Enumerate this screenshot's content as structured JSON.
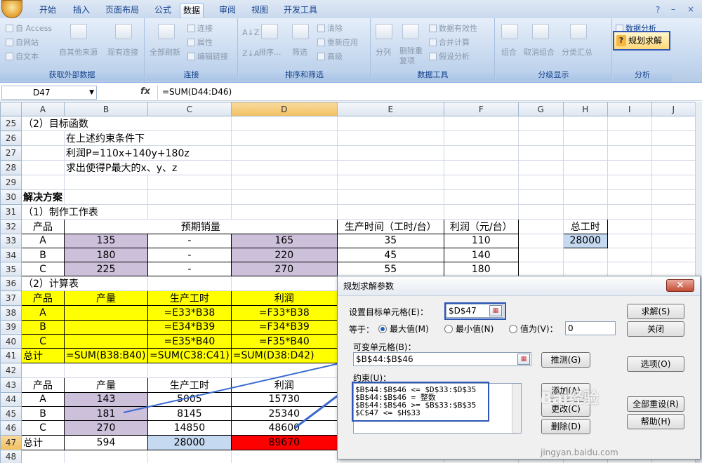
{
  "tabs": [
    "开始",
    "插入",
    "页面布局",
    "公式",
    "数据",
    "审阅",
    "视图",
    "开发工具"
  ],
  "active_tab": "数据",
  "ribbon": {
    "external": {
      "title": "获取外部数据",
      "items": [
        "自 Access",
        "自网站",
        "自文本",
        "自其他来源",
        "现有连接"
      ]
    },
    "connections": {
      "title": "连接",
      "items": [
        "全部刷新",
        "连接",
        "属性",
        "编辑链接"
      ]
    },
    "sort": {
      "title": "排序和筛选",
      "items": [
        "排序...",
        "筛选",
        "清除",
        "重新应用",
        "高级"
      ]
    },
    "tools": {
      "title": "数据工具",
      "items": [
        "分列",
        "删除重复项",
        "数据有效性",
        "合并计算",
        "假设分析"
      ]
    },
    "outline": {
      "title": "分级显示",
      "items": [
        "组合",
        "取消组合",
        "分类汇总"
      ]
    },
    "analysis": {
      "title": "分析",
      "items": [
        "数据分析",
        "规划求解"
      ]
    }
  },
  "formula_bar": {
    "name_box": "D47",
    "fx": "fx",
    "formula": "=SUM(D44:D46)"
  },
  "columns": [
    "A",
    "B",
    "C",
    "D",
    "E",
    "F",
    "G",
    "H",
    "I",
    "J"
  ],
  "selected_col": "D",
  "rows": [
    {
      "n": "25",
      "cells": [
        {
          "t": "（2）目标函数",
          "span": 3
        }
      ]
    },
    {
      "n": "26",
      "cells": [
        {
          "t": ""
        },
        {
          "t": "在上述约束条件下",
          "span": 2
        }
      ]
    },
    {
      "n": "27",
      "cells": [
        {
          "t": ""
        },
        {
          "t": "利润P=110x+140y+180z",
          "span": 2
        }
      ]
    },
    {
      "n": "28",
      "cells": [
        {
          "t": ""
        },
        {
          "t": "求出使得P最大的x、y、z",
          "span": 2
        }
      ]
    },
    {
      "n": "29",
      "cells": []
    },
    {
      "n": "30",
      "cells": [
        {
          "t": "解决方案",
          "bold": true
        }
      ]
    },
    {
      "n": "31",
      "cells": [
        {
          "t": "（1）制作工作表",
          "span": 2
        }
      ]
    },
    {
      "n": "32",
      "cells": [
        {
          "t": "产品",
          "c": "c b"
        },
        {
          "t": "预期销量",
          "span": 3,
          "c": "c b"
        },
        {
          "t": "生产时间（工时/台）",
          "c": "c b"
        },
        {
          "t": "利润（元/台）",
          "c": "c b"
        },
        {
          "t": ""
        },
        {
          "t": "总工时",
          "c": "c b"
        }
      ]
    },
    {
      "n": "33",
      "cells": [
        {
          "t": "A",
          "c": "c b"
        },
        {
          "t": "135",
          "c": "c b pur"
        },
        {
          "t": "-",
          "c": "c b"
        },
        {
          "t": "165",
          "c": "c b pur"
        },
        {
          "t": "35",
          "c": "c b"
        },
        {
          "t": "110",
          "c": "c b"
        },
        {
          "t": ""
        },
        {
          "t": "28000",
          "c": "c b blu"
        }
      ]
    },
    {
      "n": "34",
      "cells": [
        {
          "t": "B",
          "c": "c b"
        },
        {
          "t": "180",
          "c": "c b pur"
        },
        {
          "t": "-",
          "c": "c b"
        },
        {
          "t": "220",
          "c": "c b pur"
        },
        {
          "t": "45",
          "c": "c b"
        },
        {
          "t": "140",
          "c": "c b"
        }
      ]
    },
    {
      "n": "35",
      "cells": [
        {
          "t": "C",
          "c": "c b"
        },
        {
          "t": "225",
          "c": "c b pur"
        },
        {
          "t": "-",
          "c": "c b"
        },
        {
          "t": "270",
          "c": "c b pur"
        },
        {
          "t": "55",
          "c": "c b"
        },
        {
          "t": "180",
          "c": "c b"
        }
      ]
    },
    {
      "n": "36",
      "cells": [
        {
          "t": "（2）计算表",
          "span": 2
        }
      ]
    },
    {
      "n": "37",
      "cells": [
        {
          "t": "产品",
          "c": "c b yel"
        },
        {
          "t": "产量",
          "c": "c b yel"
        },
        {
          "t": "生产工时",
          "c": "c b yel"
        },
        {
          "t": "利润",
          "c": "c b yel"
        }
      ]
    },
    {
      "n": "38",
      "cells": [
        {
          "t": "A",
          "c": "c b yel"
        },
        {
          "t": "",
          "c": "b yel"
        },
        {
          "t": "=E33*B38",
          "c": "c b yel"
        },
        {
          "t": "=F33*B38",
          "c": "c b yel"
        }
      ]
    },
    {
      "n": "39",
      "cells": [
        {
          "t": "B",
          "c": "c b yel"
        },
        {
          "t": "",
          "c": "b yel"
        },
        {
          "t": "=E34*B39",
          "c": "c b yel"
        },
        {
          "t": "=F34*B39",
          "c": "c b yel"
        }
      ]
    },
    {
      "n": "40",
      "cells": [
        {
          "t": "C",
          "c": "c b yel"
        },
        {
          "t": "",
          "c": "b yel"
        },
        {
          "t": "=E35*B40",
          "c": "c b yel"
        },
        {
          "t": "=F35*B40",
          "c": "c b yel"
        }
      ]
    },
    {
      "n": "41",
      "cells": [
        {
          "t": "总计",
          "c": "b yel"
        },
        {
          "t": "=SUM(B38:B40)",
          "c": "b yel"
        },
        {
          "t": "=SUM(C38:C41)",
          "c": "b yel"
        },
        {
          "t": "=SUM(D38:D42)",
          "c": "b yel"
        }
      ]
    },
    {
      "n": "42",
      "cells": []
    },
    {
      "n": "43",
      "cells": [
        {
          "t": "产品",
          "c": "c b"
        },
        {
          "t": "产量",
          "c": "c b"
        },
        {
          "t": "生产工时",
          "c": "c b"
        },
        {
          "t": "利润",
          "c": "c b"
        }
      ]
    },
    {
      "n": "44",
      "cells": [
        {
          "t": "A",
          "c": "c b"
        },
        {
          "t": "143",
          "c": "c b pur"
        },
        {
          "t": "5005",
          "c": "c b"
        },
        {
          "t": "15730",
          "c": "c b"
        }
      ]
    },
    {
      "n": "45",
      "cells": [
        {
          "t": "B",
          "c": "c b"
        },
        {
          "t": "181",
          "c": "c b pur"
        },
        {
          "t": "8145",
          "c": "c b"
        },
        {
          "t": "25340",
          "c": "c b"
        }
      ]
    },
    {
      "n": "46",
      "cells": [
        {
          "t": "C",
          "c": "c b"
        },
        {
          "t": "270",
          "c": "c b pur"
        },
        {
          "t": "14850",
          "c": "c b"
        },
        {
          "t": "48600",
          "c": "c b"
        }
      ]
    },
    {
      "n": "47",
      "cells": [
        {
          "t": "总计",
          "c": "b"
        },
        {
          "t": "594",
          "c": "c b"
        },
        {
          "t": "28000",
          "c": "c b blu"
        },
        {
          "t": "89670",
          "c": "c b red"
        }
      ]
    },
    {
      "n": "48",
      "cells": []
    }
  ],
  "dialog": {
    "title": "规划求解参数",
    "target_label": "设置目标单元格(E)：",
    "target_value": "$D$47",
    "equals_label": "等于：",
    "opt_max": "最大值(M)",
    "opt_min": "最小值(N)",
    "opt_value": "值为(V)：",
    "value_input": "0",
    "changing_label": "可变单元格(B)：",
    "changing_value": "$B$44:$B$46",
    "constraints_label": "约束(U)：",
    "constraints": [
      "$B$44:$B$46 <= $D$33:$D$35",
      "$B$44:$B$46 = 整数",
      "$B$44:$B$46 >= $B$33:$B$35",
      "$C$47 <= $H$33"
    ],
    "btn_solve": "求解(S)",
    "btn_close": "关闭",
    "btn_guess": "推测(G)",
    "btn_options": "选项(O)",
    "btn_add": "添加(A)",
    "btn_change": "更改(C)",
    "btn_delete": "删除(D)",
    "btn_reset": "全部重设(R)",
    "btn_help": "帮助(H)"
  },
  "watermark": {
    "main": "Bai经验",
    "sub": "jingyan.baidu.com"
  }
}
